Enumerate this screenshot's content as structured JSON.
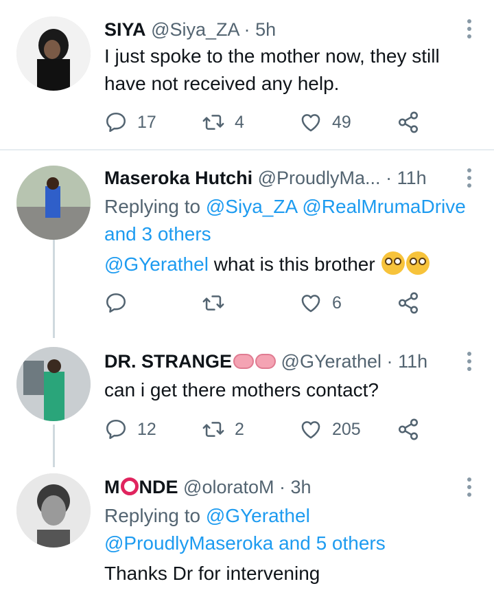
{
  "tweets": [
    {
      "name": "SIYA",
      "handle": "@Siya_ZA",
      "time": "5h",
      "text": "I just spoke to the mother now, they still have not received any help.",
      "replies": "17",
      "retweets": "4",
      "likes": "49"
    },
    {
      "name": "Maseroka Hutchi",
      "handle": "@ProudlyMa...",
      "time": "11h",
      "replying_prefix": "Replying to ",
      "replying_to": "@Siya_ZA @RealMrumaDrive and 3 others",
      "mention": "@GYerathel",
      "text": " what is this brother",
      "replies": "",
      "retweets": "",
      "likes": "6"
    },
    {
      "name": "DR. STRANGE",
      "handle": "@GYerathel",
      "time": "11h",
      "text": "can i get there mothers contact?",
      "replies": "12",
      "retweets": "2",
      "likes": "205"
    },
    {
      "name_start": "M",
      "name_end": "NDE",
      "handle": "@oloratoM",
      "time": "3h",
      "replying_prefix": "Replying to ",
      "replying_to": "@GYerathel @ProudlyMaseroka and 5 others",
      "text": "Thanks Dr for intervening"
    }
  ],
  "icons": {
    "reply": "reply-icon",
    "retweet": "retweet-icon",
    "like": "heart-icon",
    "share": "share-icon",
    "more": "more-vertical-icon"
  },
  "colors": {
    "link": "#1d9bf0",
    "secondary": "#536471",
    "divider": "#e6ecf0"
  }
}
